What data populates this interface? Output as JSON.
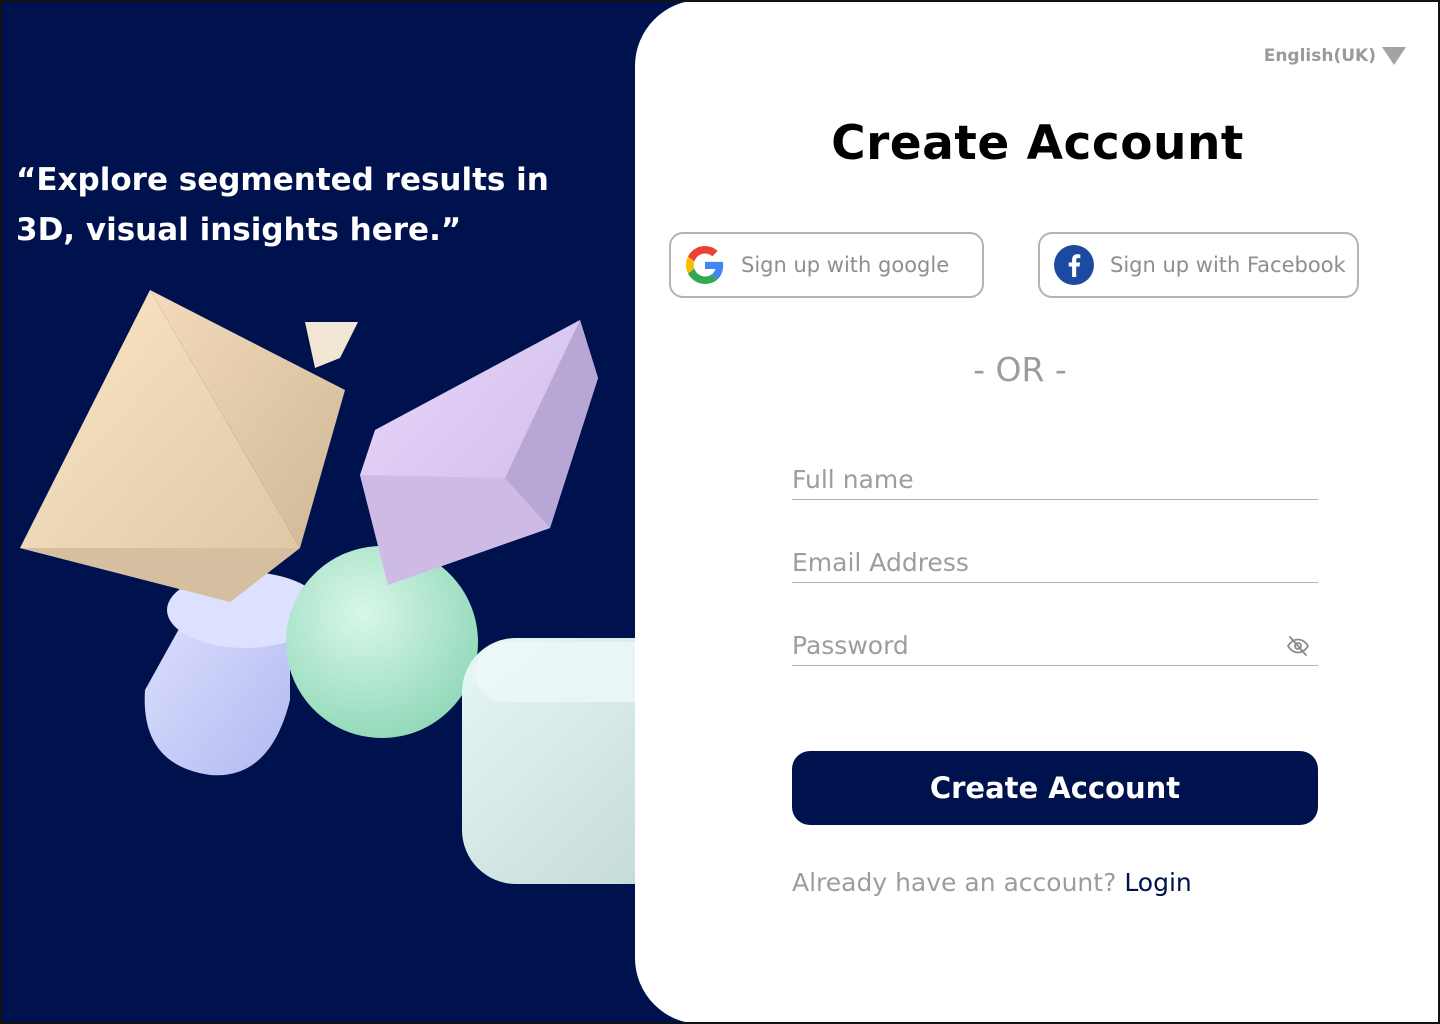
{
  "hero": {
    "tagline": "“Explore segmented results in 3D, visual insights here.”"
  },
  "language": {
    "selected": "English(UK)"
  },
  "form": {
    "title": "Create Account",
    "google_label": "Sign up with google",
    "facebook_label": "Sign up with Facebook",
    "divider": "- OR -",
    "fullname_placeholder": "Full name",
    "email_placeholder": "Email Address",
    "password_placeholder": "Password",
    "submit_label": "Create Account",
    "login_prompt": "Already have an account?",
    "login_link": "Login"
  },
  "icons": {
    "google": "google-icon",
    "facebook": "facebook-icon",
    "password_toggle": "eye-slash-icon",
    "language_dropdown": "caret-down-icon"
  },
  "colors": {
    "brand_navy": "#00124d",
    "facebook_blue": "#1b4aa0",
    "muted_text": "#9d9d9d"
  }
}
